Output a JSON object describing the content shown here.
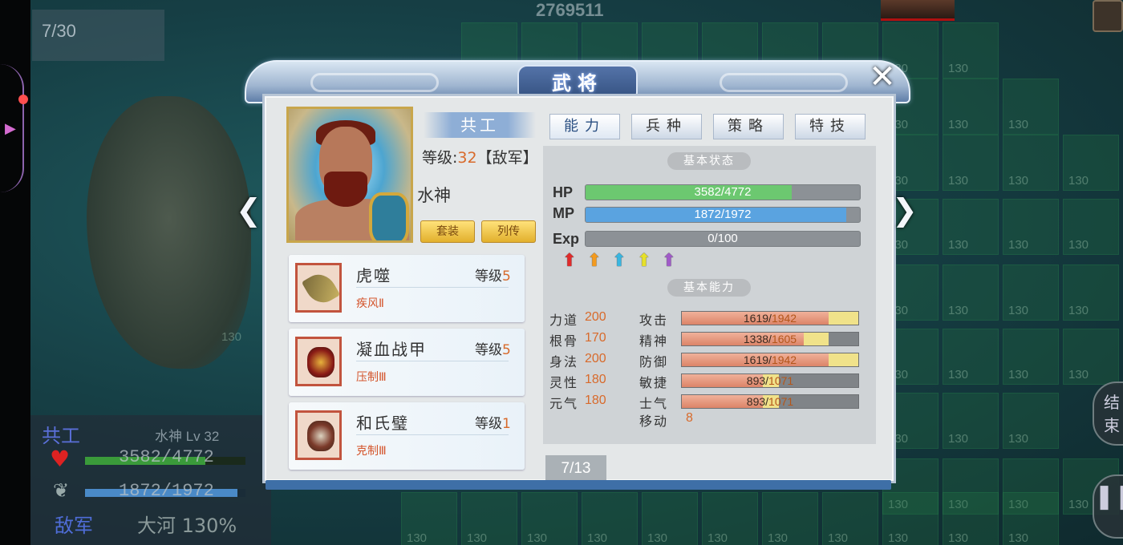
{
  "map": {
    "turn_counter": "7/30",
    "score": "2769511",
    "tile_value": "130",
    "end_turn_label": "结\n束"
  },
  "unit_status": {
    "name": "共工",
    "class_level": "水神 Lv 32",
    "hp_text": "3582/4772",
    "hp_ratio": 0.75,
    "mp_text": "1872/1972",
    "mp_ratio": 0.95,
    "faction": "敌军",
    "terrain": "大河 130%"
  },
  "dialog": {
    "title": "武将",
    "close_label": "✕",
    "prev_label": "❮",
    "next_label": "❯",
    "page_indicator": "7/13",
    "general": {
      "name": "共工",
      "level_prefix": "等级:",
      "level": "32",
      "faction_tag": "【敌军】",
      "title": "水神",
      "btn_outfit": "套装",
      "btn_biography": "列传"
    },
    "equipment": [
      {
        "name": "虎噬",
        "level_label": "等级",
        "level": "5",
        "skill": "疾风Ⅱ",
        "icon": "spear-icon"
      },
      {
        "name": "凝血战甲",
        "level_label": "等级",
        "level": "5",
        "skill": "压制Ⅲ",
        "icon": "armor-icon"
      },
      {
        "name": "和氏璧",
        "level_label": "等级",
        "level": "1",
        "skill": "克制Ⅲ",
        "icon": "jade-icon"
      }
    ],
    "tabs": [
      {
        "label": "能力",
        "active": true
      },
      {
        "label": "兵种",
        "active": false
      },
      {
        "label": "策略",
        "active": false
      },
      {
        "label": "特技",
        "active": false
      }
    ],
    "basic_status_label": "基本状态",
    "bars": {
      "hp": {
        "label": "HP",
        "text": "3582/4772",
        "ratio": 0.75,
        "color": "#6cc870"
      },
      "mp": {
        "label": "MP",
        "text": "1872/1972",
        "ratio": 0.95,
        "color": "#5aa3e0"
      },
      "exp": {
        "label": "Exp",
        "text": "0/100",
        "ratio": 0.0,
        "color": "#9aa"
      }
    },
    "upgrade_arrows": [
      "#e02b2b",
      "#f39a1e",
      "#39b6e0",
      "#e6e02a",
      "#a05ac8"
    ],
    "basic_ability_label": "基本能力",
    "base_attrs": [
      {
        "label": "力道",
        "value": "200"
      },
      {
        "label": "根骨",
        "value": "170"
      },
      {
        "label": "身法",
        "value": "200"
      },
      {
        "label": "灵性",
        "value": "180"
      },
      {
        "label": "元气",
        "value": "180"
      }
    ],
    "combat_attrs": [
      {
        "label": "攻击",
        "current": "1619",
        "max": "1942",
        "cur_ratio": 0.83,
        "max_ratio": 1.0
      },
      {
        "label": "精神",
        "current": "1338",
        "max": "1605",
        "cur_ratio": 0.69,
        "max_ratio": 0.83
      },
      {
        "label": "防御",
        "current": "1619",
        "max": "1942",
        "cur_ratio": 0.83,
        "max_ratio": 1.0
      },
      {
        "label": "敏捷",
        "current": "893",
        "max": "1071",
        "cur_ratio": 0.46,
        "max_ratio": 0.55
      },
      {
        "label": "士气",
        "current": "893",
        "max": "1071",
        "cur_ratio": 0.46,
        "max_ratio": 0.55
      }
    ],
    "move_label": "移动",
    "move_value": "8"
  }
}
